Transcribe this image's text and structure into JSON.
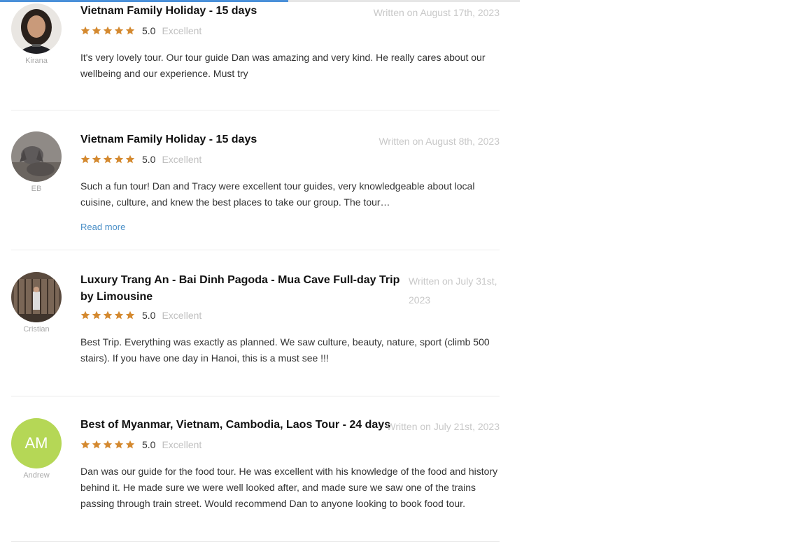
{
  "page": {
    "progress_fraction": 0.555
  },
  "colors": {
    "star": "#d4892f",
    "accent": "#4a90d9",
    "initials_bg": "#b5d756"
  },
  "reviews": [
    {
      "reviewer": "Kirana",
      "avatar": "photo-woman",
      "title": "Vietnam Family Holiday - 15 days",
      "date": "Written on August 17th, 2023",
      "score": "5.0",
      "label": "Excellent",
      "stars": 5,
      "text": "It's very lovely tour. Our tour guide Dan was amazing and very kind. He really cares about our wellbeing and our experience. Must try"
    },
    {
      "reviewer": "EB",
      "avatar": "photo-dog",
      "title": "Vietnam Family Holiday - 15 days",
      "date": "Written on August 8th, 2023",
      "score": "5.0",
      "label": "Excellent",
      "stars": 5,
      "text": "Such a fun tour! Dan and Tracy were excellent tour guides, very knowledgeable about local cuisine, culture, and knew the best places to take our group. The tour…",
      "read_more": "Read more"
    },
    {
      "reviewer": "Cristian",
      "avatar": "photo-building",
      "title": "Luxury Trang An - Bai Dinh Pagoda - Mua Cave Full-day Trip by Limousine",
      "date": "Written on July 31st, 2023",
      "score": "5.0",
      "label": "Excellent",
      "stars": 5,
      "text": "Best Trip. Everything was exactly as planned. We saw culture, beauty, nature, sport (climb 500 stairs). If you have one day in Hanoi, this is a must see !!!"
    },
    {
      "reviewer": "Andrew",
      "avatar": "initials",
      "initials": "AM",
      "title": "Best of Myanmar, Vietnam, Cambodia, Laos Tour - 24 days",
      "date": "Written on July 21st, 2023",
      "score": "5.0",
      "label": "Excellent",
      "stars": 5,
      "text": "Dan was our guide for the food tour. He was excellent with his knowledge of the food and history behind it. He made sure we were well looked after, and made sure we saw one of the trains passing through train street. Would recommend Dan to anyone looking to book food tour."
    }
  ]
}
